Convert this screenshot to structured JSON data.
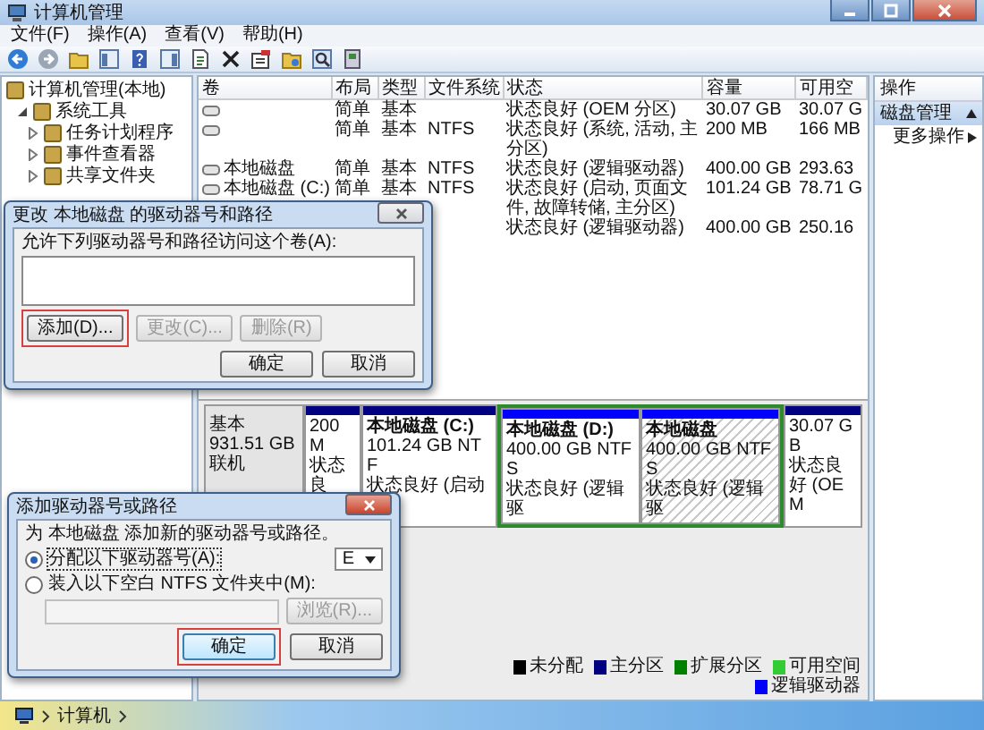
{
  "window": {
    "title": "计算机管理"
  },
  "menu": [
    "文件(F)",
    "操作(A)",
    "查看(V)",
    "帮助(H)"
  ],
  "tree": {
    "items": [
      {
        "label": "计算机管理(本地)",
        "children": [
          {
            "label": "系统工具",
            "expanded": true,
            "children": [
              {
                "label": "任务计划程序",
                "expanded": false
              },
              {
                "label": "事件查看器",
                "expanded": false
              },
              {
                "label": "共享文件夹",
                "expanded": false
              }
            ]
          }
        ]
      }
    ]
  },
  "volumes": {
    "columns": [
      "卷",
      "布局",
      "类型",
      "文件系统",
      "状态",
      "容量",
      "可用空"
    ],
    "rows": [
      {
        "disk_icon": true,
        "cells": [
          null,
          "简单",
          "基本",
          null,
          "状态良好 (OEM 分区)",
          "30.07 GB",
          "30.07 G"
        ]
      },
      {
        "disk_icon": true,
        "cells": [
          null,
          "简单",
          "基本",
          "NTFS",
          "状态良好 (系统, 活动, 主分区)",
          "200 MB",
          "166 MB"
        ]
      },
      {
        "disk_icon": true,
        "cells": [
          "本地磁盘",
          "简单",
          "基本",
          "NTFS",
          "状态良好 (逻辑驱动器)",
          "400.00 GB",
          "293.63"
        ]
      },
      {
        "disk_icon": true,
        "cells": [
          "本地磁盘 (C:)",
          "简单",
          "基本",
          "NTFS",
          "状态良好 (启动, 页面文件, 故障转储, 主分区)",
          "101.24 GB",
          "78.71 G"
        ]
      },
      {
        "disk_icon": false,
        "cells": [
          null,
          null,
          null,
          null,
          "状态良好 (逻辑驱动器)",
          "400.00 GB",
          "250.16"
        ]
      }
    ]
  },
  "disk": {
    "lines": [
      "基本",
      "931.51 GB",
      "联机"
    ],
    "partitions": [
      {
        "kind": "primary",
        "selected": false,
        "lines": [
          "200 M",
          "状态良"
        ]
      },
      {
        "kind": "primary",
        "selected": false,
        "name": "本地磁盘 (C:)",
        "lines": [
          "101.24 GB NTF",
          "状态良好 (启动"
        ]
      },
      {
        "kind": "extended",
        "children": [
          {
            "kind": "logical",
            "selected": false,
            "name": "本地磁盘 (D:)",
            "lines": [
              "400.00 GB NTFS",
              "状态良好 (逻辑驱"
            ]
          },
          {
            "kind": "logical",
            "selected": true,
            "name": "本地磁盘",
            "lines": [
              "400.00 GB NTFS",
              "状态良好 (逻辑驱"
            ]
          }
        ]
      },
      {
        "kind": "primary",
        "selected": false,
        "lines": [
          "30.07 GB",
          "状态良好 (OEM"
        ]
      }
    ]
  },
  "legend": [
    {
      "label": "未分配",
      "color": "#000000"
    },
    {
      "label": "主分区",
      "color": "#000080"
    },
    {
      "label": "扩展分区",
      "color": "#008000"
    },
    {
      "label": "可用空间",
      "color": "#33cc33"
    },
    {
      "label": "逻辑驱动器",
      "color": "#0000ff"
    }
  ],
  "actions": {
    "header": "操作",
    "items": [
      {
        "label": "磁盘管理",
        "kind": "section",
        "selected": true
      },
      {
        "label": "更多操作",
        "kind": "submenu",
        "selected": false
      }
    ]
  },
  "dialog_change": {
    "title": "更改 本地磁盘 的驱动器号和路径",
    "prompt": "允许下列驱动器号和路径访问这个卷(A):",
    "buttons": [
      {
        "label": "添加(D)...",
        "disabled": false,
        "highlighted": true
      },
      {
        "label": "更改(C)...",
        "disabled": true,
        "highlighted": false
      },
      {
        "label": "删除(R)",
        "disabled": true,
        "highlighted": false
      }
    ],
    "footer_buttons": [
      {
        "label": "确定",
        "highlighted": false
      },
      {
        "label": "取消",
        "highlighted": false
      }
    ]
  },
  "dialog_add": {
    "title": "添加驱动器号或路径",
    "prompt": "为 本地磁盘 添加新的驱动器号或路径。",
    "options": [
      {
        "kind": "letter",
        "label": "分配以下驱动器号(A):",
        "selected": true,
        "value": "E"
      },
      {
        "kind": "folder",
        "label": "装入以下空白 NTFS 文件夹中(M):",
        "selected": false,
        "button": "浏览(R)..."
      }
    ],
    "footer_buttons": [
      {
        "label": "确定",
        "highlighted": true
      },
      {
        "label": "取消",
        "highlighted": false
      }
    ]
  },
  "explorer": {
    "path": [
      "计算机"
    ]
  }
}
